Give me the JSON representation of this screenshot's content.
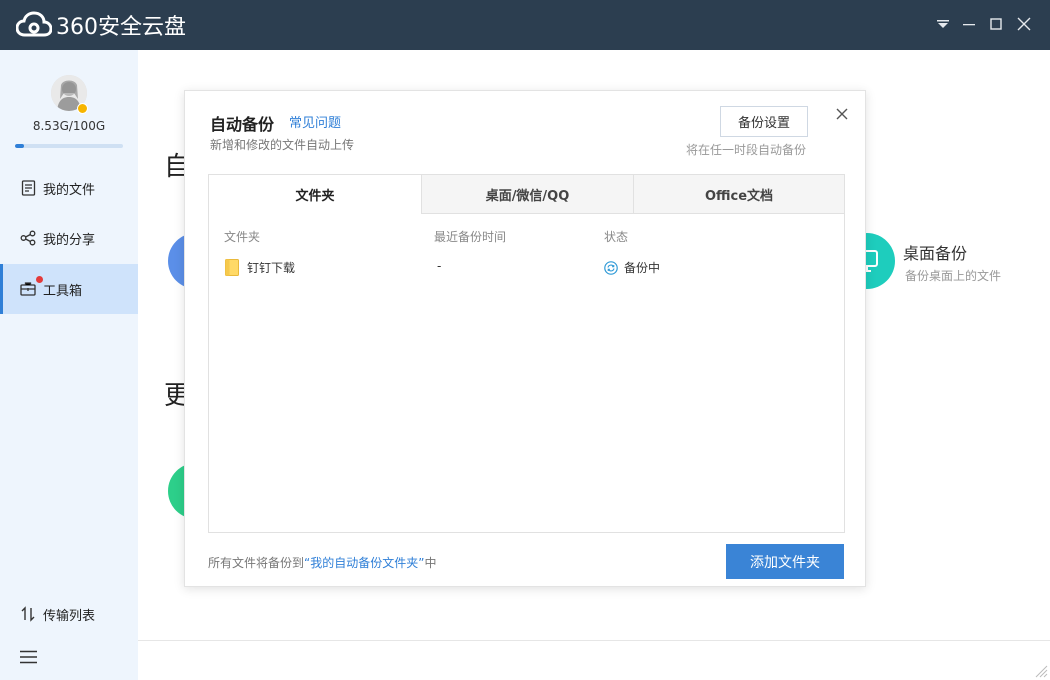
{
  "app": {
    "title": "360安全云盘",
    "logo_icon": "cloud-logo-icon"
  },
  "window_controls": {
    "menu_icon": "dropdown-menu-icon",
    "minimize_icon": "minimize-icon",
    "maximize_icon": "maximize-icon",
    "close_icon": "close-icon"
  },
  "sidebar": {
    "quota": "8.53G/100G",
    "quota_used_fraction": 0.0853,
    "items": [
      {
        "label": "我的文件",
        "icon": "file-list-icon"
      },
      {
        "label": "我的分享",
        "icon": "share-icon"
      },
      {
        "label": "工具箱",
        "icon": "toolbox-icon"
      }
    ],
    "transfer_label": "传输列表",
    "menu_icon": "hamburger-menu-icon"
  },
  "background": {
    "heading1": "自",
    "heading2": "更",
    "desktop_backup_title": "桌面备份",
    "desktop_backup_desc": "备份桌面上的文件"
  },
  "dialog": {
    "title": "自动备份",
    "faq_link": "常见问题",
    "subtitle": "新增和修改的文件自动上传",
    "settings_button": "备份设置",
    "schedule_hint": "将在任一时段自动备份",
    "tabs": [
      {
        "label": "文件夹",
        "active": true
      },
      {
        "label": "桌面/微信/QQ",
        "active": false
      },
      {
        "label": "Office文档",
        "active": false
      }
    ],
    "columns": {
      "folder": "文件夹",
      "last_backup": "最近备份时间",
      "status": "状态"
    },
    "rows": [
      {
        "folder": "钉钉下载",
        "last_backup": "-",
        "status": "备份中"
      }
    ],
    "footer": {
      "prefix": "所有文件将备份到",
      "link": "“我的自动备份文件夹”",
      "suffix": "中"
    },
    "add_button": "添加文件夹"
  },
  "colors": {
    "titlebar": "#2c3e50",
    "accent": "#3a84d6",
    "sidebar_bg": "#eef5fd",
    "sidebar_active": "#cfe3fb"
  }
}
